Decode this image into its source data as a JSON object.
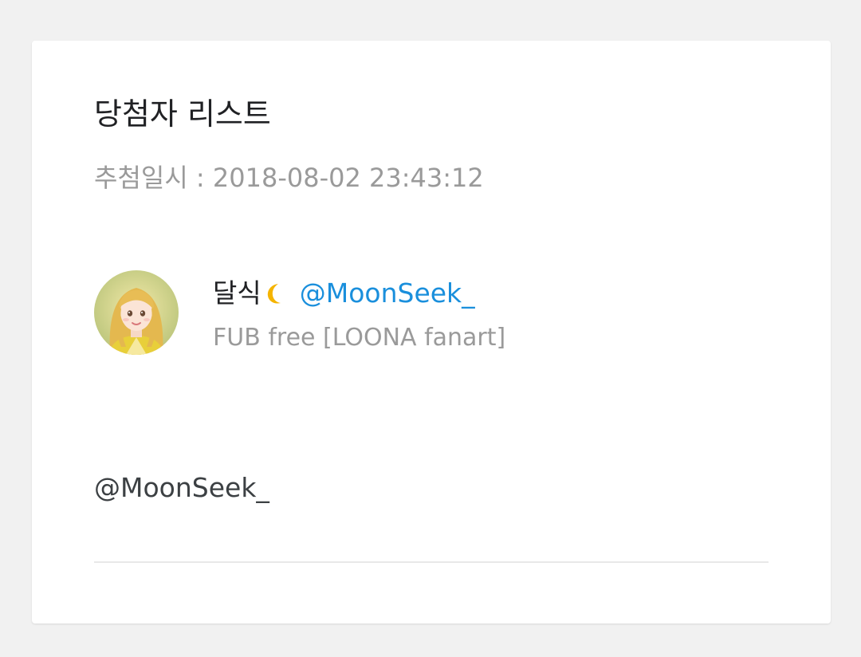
{
  "card": {
    "title": "당첨자 리스트",
    "draw_date": "추첨일시 : 2018-08-02 23:43:12"
  },
  "winner": {
    "avatar_icon": "avatar-illustration",
    "display_name": "달식",
    "name_emoji_icon": "crescent-moon-icon",
    "handle": "@MoonSeek_",
    "bio": "FUB free [LOONA fanart]"
  },
  "mention": {
    "text": "@MoonSeek_"
  },
  "colors": {
    "background": "#f1f1f1",
    "card": "#ffffff",
    "title_text": "#202124",
    "muted_text": "#9a9a9a",
    "link": "#1a8fdc",
    "moon": "#f5b400",
    "divider": "#e8e8e8"
  }
}
